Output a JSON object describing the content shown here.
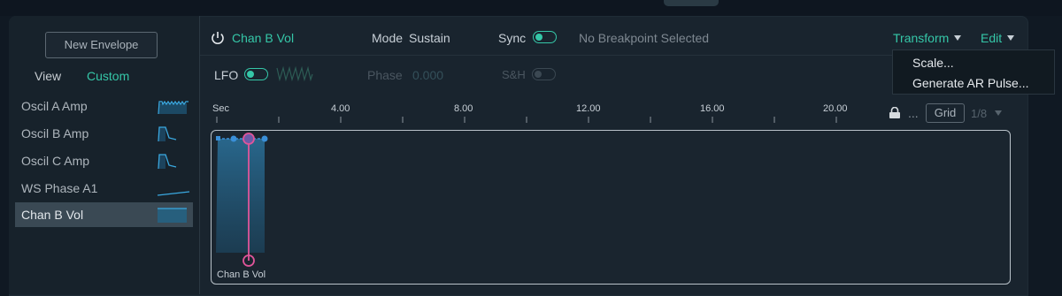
{
  "sidebar": {
    "new_envelope": "New Envelope",
    "view_label": "View",
    "custom_label": "Custom",
    "items": [
      {
        "label": "Oscil A Amp",
        "thumb": "multi-pulse"
      },
      {
        "label": "Oscil B Amp",
        "thumb": "pulse"
      },
      {
        "label": "Oscil C Amp",
        "thumb": "pulse"
      },
      {
        "label": "WS Phase A1",
        "thumb": "ramp"
      },
      {
        "label": "Chan B Vol",
        "thumb": "flat",
        "selected": true
      }
    ]
  },
  "header": {
    "title": "Chan B Vol",
    "mode_label": "Mode",
    "mode_value": "Sustain",
    "sync_label": "Sync",
    "sync_on": true,
    "status": "No Breakpoint Selected",
    "transform": "Transform",
    "edit": "Edit"
  },
  "lfo_row": {
    "lfo_label": "LFO",
    "lfo_on": true,
    "phase_label": "Phase",
    "phase_value": "0.000",
    "sh_label": "S&H",
    "sh_on": false
  },
  "transform_menu": {
    "items": [
      "Scale...",
      "Generate AR Pulse..."
    ]
  },
  "ruler": {
    "unit": "Sec",
    "ticks": [
      "4.00",
      "8.00",
      "12.00",
      "16.00",
      "20.00"
    ]
  },
  "grid": {
    "label": "Grid",
    "value": "1/8",
    "more": "..."
  },
  "canvas": {
    "envelope_label": "Chan B Vol"
  },
  "colors": {
    "accent": "#35c7a8",
    "playhead": "#e0559a",
    "breakpoint": "#3a8fd8",
    "envelope_fill": "#1f5a7e"
  },
  "icons": {
    "power": "power-icon",
    "lock": "lock-icon",
    "lfo_wave": "sawtooth-icon"
  }
}
